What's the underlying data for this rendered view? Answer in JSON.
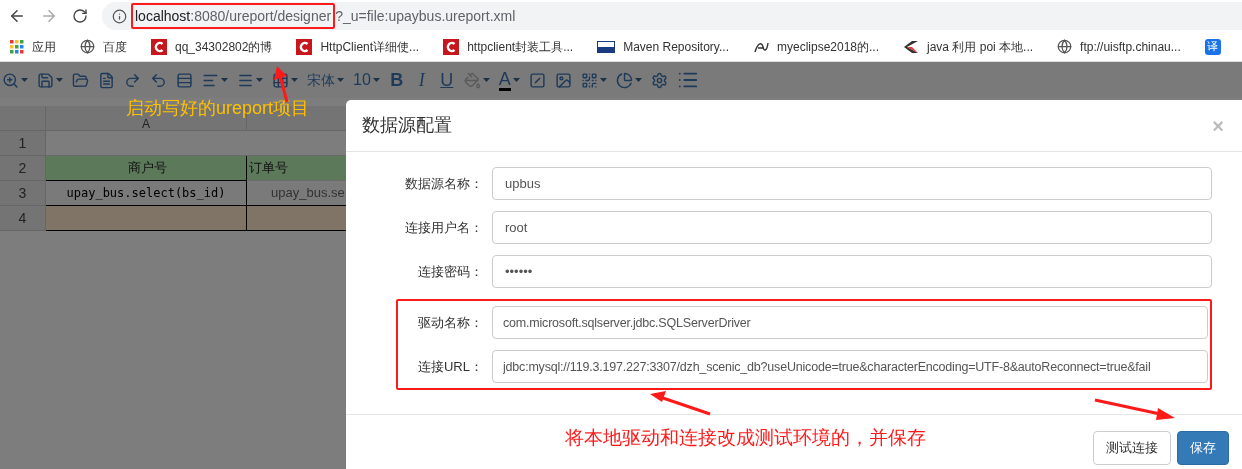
{
  "address_bar": {
    "host": "localhost",
    "path": ":8080/ureport/designer",
    "query": "?_u=file:upaybus.ureport.xml"
  },
  "bookmarks": [
    {
      "kind": "apps",
      "label": "应用"
    },
    {
      "kind": "globe",
      "label": "百度"
    },
    {
      "kind": "csdn",
      "label": "qq_34302802的博"
    },
    {
      "kind": "csdn",
      "label": "HttpClient详细使..."
    },
    {
      "kind": "csdn",
      "label": "httpclient封装工具..."
    },
    {
      "kind": "mvn",
      "label": "Maven Repository..."
    },
    {
      "kind": "glyph",
      "label": "myeclipse2018的..."
    },
    {
      "kind": "java",
      "label": "java 利用 poi 本地..."
    },
    {
      "kind": "globe",
      "label": "ftp://uisftp.chinau..."
    },
    {
      "kind": "translate",
      "icon_text": "译"
    }
  ],
  "toolbar": {
    "font": "宋体",
    "size": "10",
    "format_buttons": [
      "B",
      "I",
      "U"
    ],
    "font_color_button": "A"
  },
  "sheet": {
    "columns": [
      "A"
    ],
    "rows": [
      {
        "number": "1",
        "cells": []
      },
      {
        "number": "2",
        "kind": "header",
        "cells": [
          "商户号",
          "订单号"
        ]
      },
      {
        "number": "3",
        "kind": "data",
        "cells": [
          "upay_bus.select(bs_id)",
          "upay_bus.se"
        ]
      },
      {
        "number": "4",
        "kind": "footer",
        "cells": []
      }
    ]
  },
  "dialog": {
    "title": "数据源配置",
    "close": "×",
    "fields": [
      {
        "label": "数据源名称：",
        "value": "upbus"
      },
      {
        "label": "连接用户名：",
        "value": "root"
      },
      {
        "label": "连接密码：",
        "value": "••••••"
      },
      {
        "label": "驱动名称：",
        "value": "com.microsoft.sqlserver.jdbc.SQLServerDriver"
      },
      {
        "label": "连接URL：",
        "value": "jdbc:mysql://119.3.197.227:3307/dzh_scenic_db?useUnicode=true&characterEncoding=UTF-8&autoReconnect=true&fail"
      }
    ],
    "buttons": [
      {
        "label": "测试连接",
        "kind": "default"
      },
      {
        "label": "保存",
        "kind": "primary"
      }
    ]
  },
  "annotations": [
    {
      "kind": "yellow",
      "text": "启动写好的ureport项目"
    },
    {
      "kind": "red",
      "text": "将本地驱动和连接改成测试环境的，并保存"
    }
  ]
}
